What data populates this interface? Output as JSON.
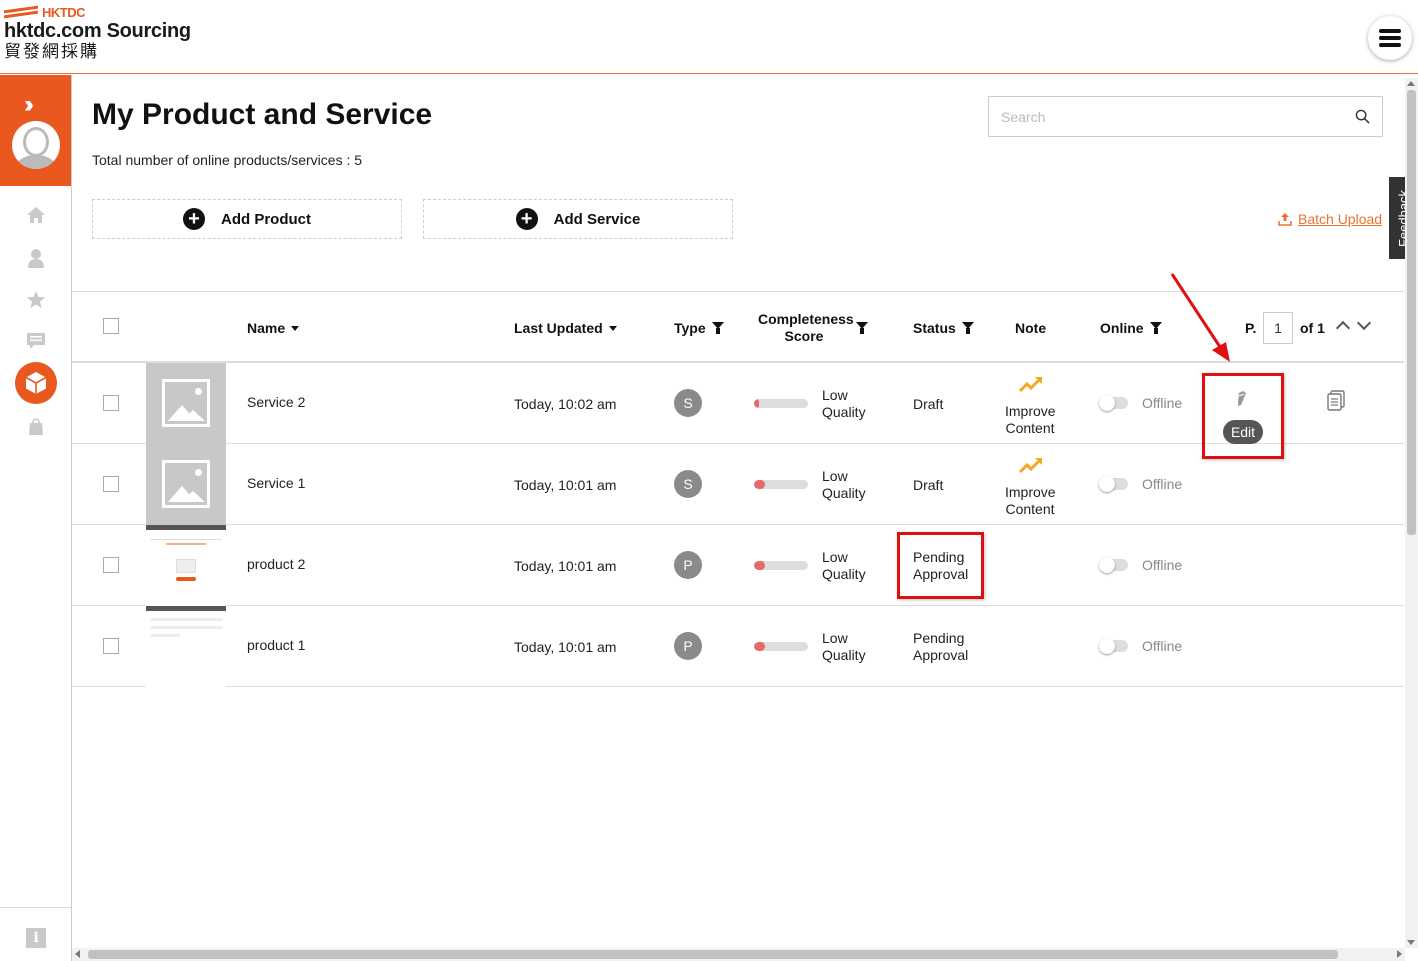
{
  "header": {
    "brand": "HKTDC",
    "site_name": "hktdc.com Sourcing",
    "site_name_cn": "貿發網採購"
  },
  "page": {
    "title": "My Product and Service",
    "total_count": "Total number of online products/services : 5",
    "search_placeholder": "Search",
    "add_product_label": "Add Product",
    "add_service_label": "Add Service",
    "batch_upload_label": "Batch Upload",
    "feedback_label": "Feedback"
  },
  "table": {
    "columns": {
      "name": "Name",
      "last_updated": "Last Updated",
      "type": "Type",
      "completeness": "Completeness Score",
      "status": "Status",
      "note": "Note",
      "online": "Online"
    },
    "pagination": {
      "prefix": "P.",
      "page": "1",
      "suffix": "of 1"
    },
    "rows": [
      {
        "name": "Service 2",
        "updated": "Today, 10:02 am",
        "type": "S",
        "score_label_1": "Low",
        "score_label_2": "Quality",
        "score": 0.1,
        "status_1": "Draft",
        "status_2": "",
        "note_1": "Improve",
        "note_2": "Content",
        "online": "Offline"
      },
      {
        "name": "Service 1",
        "updated": "Today, 10:01 am",
        "type": "S",
        "score_label_1": "Low",
        "score_label_2": "Quality",
        "score": 0.2,
        "status_1": "Draft",
        "status_2": "",
        "note_1": "Improve",
        "note_2": "Content",
        "online": "Offline"
      },
      {
        "name": "product 2",
        "updated": "Today, 10:01 am",
        "type": "P",
        "score_label_1": "Low",
        "score_label_2": "Quality",
        "score": 0.2,
        "status_1": "Pending",
        "status_2": "Approval",
        "note_1": "",
        "note_2": "",
        "online": "Offline"
      },
      {
        "name": "product 1",
        "updated": "Today, 10:01 am",
        "type": "P",
        "score_label_1": "Low",
        "score_label_2": "Quality",
        "score": 0.2,
        "status_1": "Pending",
        "status_2": "Approval",
        "note_1": "",
        "note_2": "",
        "online": "Offline"
      }
    ],
    "edit_tooltip": "Edit"
  },
  "colors": {
    "accent": "#e8581f",
    "highlight": "#e01010",
    "score_fill": "#e66a6a",
    "trend": "#f5a623"
  }
}
